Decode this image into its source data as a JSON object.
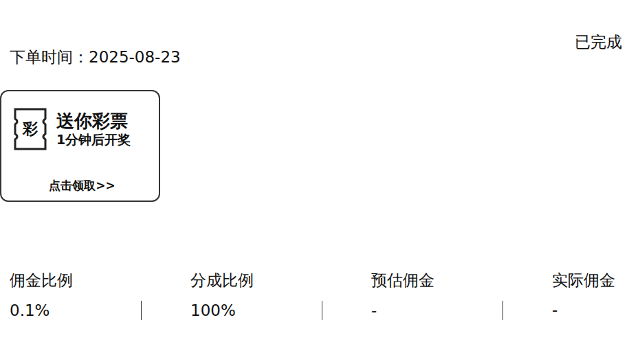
{
  "order": {
    "time": "下单时间：2025-08-23",
    "status": "已完成"
  },
  "promo": {
    "icon_text": "彩",
    "title": "送你彩票",
    "subtitle": "1分钟后开奖",
    "cta": "点击领取>>"
  },
  "stats": [
    {
      "label": "佣金比例",
      "value": "0.1%"
    },
    {
      "label": "分成比例",
      "value": "100%"
    },
    {
      "label": "预估佣金",
      "value": "-"
    },
    {
      "label": "实际佣金",
      "value": "-"
    }
  ]
}
